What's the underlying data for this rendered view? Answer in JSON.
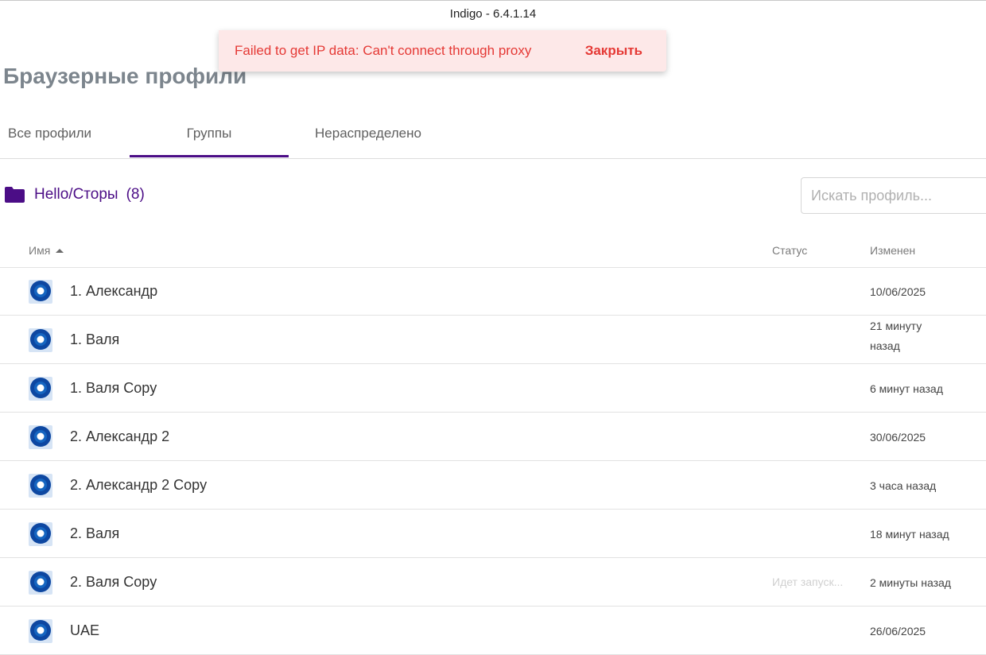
{
  "window": {
    "title": "Indigo - 6.4.1.14"
  },
  "toast": {
    "message": "Failed to get IP data: Can't connect through proxy",
    "close_label": "Закрыть"
  },
  "page": {
    "title": "Браузерные профили"
  },
  "tabs": [
    {
      "label": "Все профили",
      "active": false
    },
    {
      "label": "Группы",
      "active": true
    },
    {
      "label": "Нераспределено",
      "active": false
    }
  ],
  "group": {
    "name": "Hello/Сторы",
    "count": "(8)",
    "icon": "folder-icon"
  },
  "search": {
    "placeholder": "Искать профиль..."
  },
  "table": {
    "columns": {
      "name": "Имя",
      "status": "Статус",
      "changed": "Изменен"
    },
    "rows": [
      {
        "name": "1. Александр",
        "status": "",
        "changed": "10/06/2025"
      },
      {
        "name": "1. Валя",
        "status": "",
        "changed": "21 минуту назад"
      },
      {
        "name": "1. Валя Copy",
        "status": "",
        "changed": "6 минут назад"
      },
      {
        "name": "2. Александр 2",
        "status": "",
        "changed": "30/06/2025"
      },
      {
        "name": "2. Александр 2 Copy",
        "status": "",
        "changed": "3 часа назад"
      },
      {
        "name": "2. Валя",
        "status": "",
        "changed": "18 минут назад"
      },
      {
        "name": "2. Валя Copy",
        "status": "Идет запуск...",
        "changed": "2 минуты назад"
      },
      {
        "name": "UAE",
        "status": "",
        "changed": "26/06/2025"
      }
    ]
  },
  "colors": {
    "accent": "#4b0d86",
    "error": "#e53935",
    "toast_bg": "#fde8e8",
    "browser_icon": "#0d47a1"
  }
}
